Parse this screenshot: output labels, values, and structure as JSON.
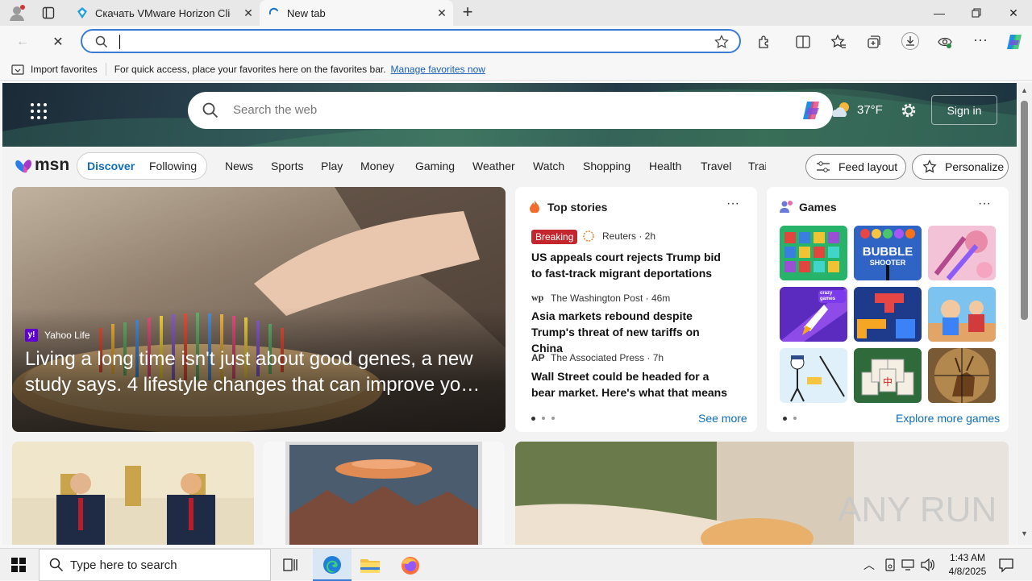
{
  "browser": {
    "tabs": [
      {
        "title": "Скачать VMware Horizon Client"
      },
      {
        "title": "New tab"
      }
    ],
    "address": {
      "value": ""
    },
    "favorites_bar": {
      "import_label": "Import favorites",
      "message": "For quick access, place your favorites here on the favorites bar.",
      "manage_link": "Manage favorites now"
    }
  },
  "msn": {
    "search_placeholder": "Search the web",
    "temperature": "37°F",
    "sign_in": "Sign in",
    "logo": "msn",
    "feed_tabs": [
      "Discover",
      "Following"
    ],
    "categories": [
      "News",
      "Sports",
      "Play",
      "Money",
      "Gaming",
      "Weather",
      "Watch",
      "Shopping",
      "Health",
      "Travel",
      "Trai"
    ],
    "feed_layout": "Feed layout",
    "personalize": "Personalize",
    "hero_story": {
      "source": "Yahoo Life",
      "title": "Living a long time isn't just about good genes, a new study says. 4 lifestyle changes that can improve yo…"
    },
    "top_stories": {
      "heading": "Top stories",
      "see_more": "See more",
      "items": [
        {
          "badge": "Breaking",
          "source": "Reuters · 2h",
          "title": "US appeals court rejects Trump bid to fast-track migrant deportations"
        },
        {
          "source": "The Washington Post · 46m",
          "title": "Asia markets rebound despite Trump's threat of new tariffs on China"
        },
        {
          "source": "The Associated Press · 7h",
          "title": "Wall Street could be headed for a bear market. Here's what that means"
        }
      ]
    },
    "games": {
      "heading": "Games",
      "explore": "Explore more games",
      "bubble_line1": "BUBBLE",
      "bubble_line2": "SHOOTER",
      "crazy_label": "crazy games"
    }
  },
  "watermark": "ANY RUN",
  "taskbar": {
    "search_placeholder": "Type here to search",
    "time": "1:43 AM",
    "date": "4/8/2025"
  }
}
